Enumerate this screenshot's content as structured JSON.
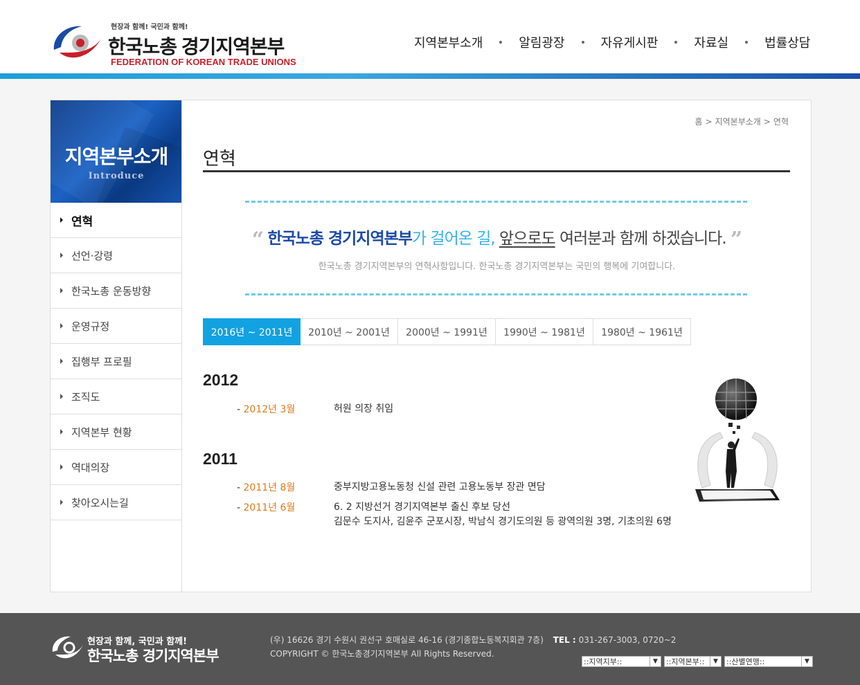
{
  "header": {
    "logo_slogan": "현장과 함께! 국민과 함께!",
    "logo_name": "한국노총 경기지역본부",
    "logo_en": "FEDERATION OF KOREAN TRADE UNIONS",
    "nav": [
      "지역본부소개",
      "알림광장",
      "자유게시판",
      "자료실",
      "법률상담"
    ]
  },
  "sidebar": {
    "title": "지역본부소개",
    "subtitle": "Introduce",
    "items": [
      "연혁",
      "선언·강령",
      "한국노총 운동방향",
      "운영규정",
      "집행부 프로필",
      "조직도",
      "지역본부 현황",
      "역대의장",
      "찾아오시는길"
    ]
  },
  "breadcrumb": [
    "홈",
    "지역본부소개",
    "연혁"
  ],
  "page_title": "연혁",
  "quote": {
    "part1": "한국노총 경기지역본부",
    "part2": "가 걸어온 길,",
    "part3": "앞으로도",
    "part4": "여러분과 함께 하겠습니다.",
    "sub": "한국노총 경기지역본부의 연혁사항입니다. 한국노총 경기지역본부는 국민의 행복에 기여합니다."
  },
  "tabs": [
    "2016년 ~ 2011년",
    "2010년 ~ 2001년",
    "2000년 ~ 1991년",
    "1990년 ~ 1981년",
    "1980년 ~ 1961년"
  ],
  "timeline": [
    {
      "year": "2012",
      "events": [
        {
          "date": "2012년 3월",
          "lines": [
            "허원 의장 취임"
          ]
        }
      ]
    },
    {
      "year": "2011",
      "events": [
        {
          "date": "2011년 8월",
          "lines": [
            "중부지방고용노동청 신설 관련 고용노동부 장관 면담"
          ]
        },
        {
          "date": "2011년 6월",
          "lines": [
            "6. 2 지방선거 경기지역본부 출신 후보 당선",
            "김문수 도지사, 김윤주 군포시장, 박남식 경기도의원 등 광역의원 3명, 기초의원 6명"
          ]
        }
      ]
    }
  ],
  "footer": {
    "slogan": "현장과 함께, 국민과 함께!",
    "name": "한국노총 경기지역본부",
    "address": "(우) 16626 경기 수원시 권선구 호매실로 46-16 (경기종합노동복지회관 7층)",
    "tel_label": "TEL :",
    "tel": "031-267-3003, 0720~2",
    "copyright": "COPYRIGHT © 한국노총경기지역본부 All Rights Reserved.",
    "selects": [
      "::지역지부::",
      "::지역본부::",
      "::산별연맹::"
    ]
  },
  "colors": {
    "accent": "#12a2e2",
    "brand_blue": "#1b4aa6",
    "date_orange": "#e07a1a"
  }
}
